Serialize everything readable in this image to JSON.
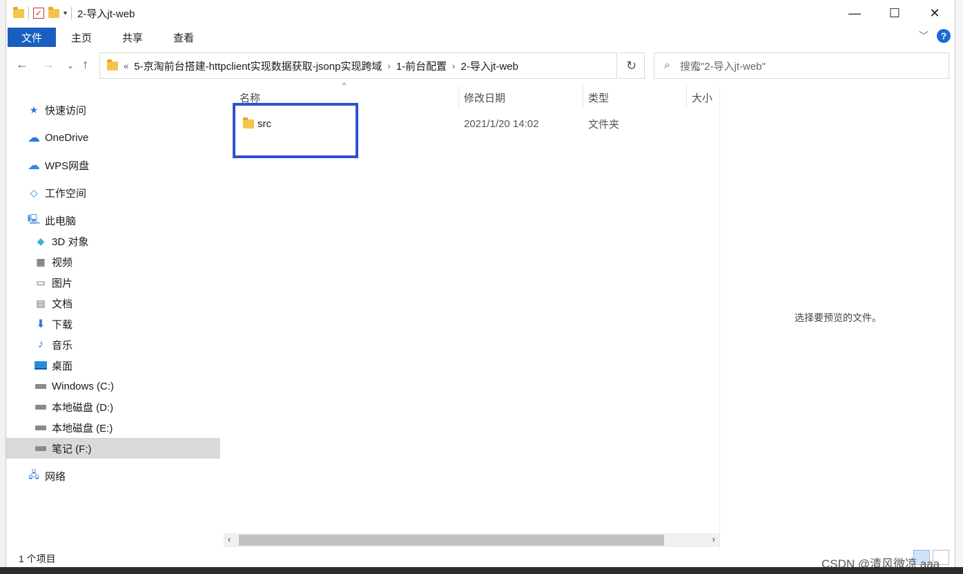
{
  "window": {
    "title": "2-导入jt-web"
  },
  "ribbon": {
    "tabs": [
      "文件",
      "主页",
      "共享",
      "查看"
    ],
    "help_label": "?"
  },
  "address": {
    "prefix": "«",
    "crumbs": [
      "5-京淘前台搭建-httpclient实现数据获取-jsonp实现跨域",
      "1-前台配置",
      "2-导入jt-web"
    ],
    "search_placeholder": "搜索\"2-导入jt-web\""
  },
  "sidebar": {
    "items": [
      {
        "label": "快速访问",
        "icon": "star-icon"
      },
      {
        "label": "OneDrive",
        "icon": "cloud-icon"
      },
      {
        "label": "WPS网盘",
        "icon": "wps-cloud-icon"
      },
      {
        "label": "工作空间",
        "icon": "workspace-icon"
      },
      {
        "label": "此电脑",
        "icon": "computer-icon"
      },
      {
        "label": "3D 对象",
        "icon": "cube-icon"
      },
      {
        "label": "视频",
        "icon": "video-icon"
      },
      {
        "label": "图片",
        "icon": "picture-icon"
      },
      {
        "label": "文档",
        "icon": "document-icon"
      },
      {
        "label": "下载",
        "icon": "download-icon"
      },
      {
        "label": "音乐",
        "icon": "music-icon"
      },
      {
        "label": "桌面",
        "icon": "desktop-icon"
      },
      {
        "label": "Windows (C:)",
        "icon": "drive-icon"
      },
      {
        "label": "本地磁盘 (D:)",
        "icon": "drive-icon"
      },
      {
        "label": "本地磁盘 (E:)",
        "icon": "drive-icon"
      },
      {
        "label": "笔记 (F:)",
        "icon": "drive-icon"
      },
      {
        "label": "网络",
        "icon": "network-icon"
      }
    ],
    "selected": "笔记 (F:)"
  },
  "columns": {
    "name": "名称",
    "modified": "修改日期",
    "type": "类型",
    "size": "大小"
  },
  "files": [
    {
      "name": "src",
      "modified": "2021/1/20 14:02",
      "type": "文件夹",
      "size": ""
    }
  ],
  "preview": {
    "empty_text": "选择要预览的文件。"
  },
  "status": {
    "count": "1 个项目"
  },
  "watermark": "CSDN @清风微凉 aaa",
  "colors": {
    "accent": "#1a5fbf",
    "highlight_box": "#3050d0",
    "selected_bg": "#d9d9d9",
    "folder": "#f4c54a"
  }
}
